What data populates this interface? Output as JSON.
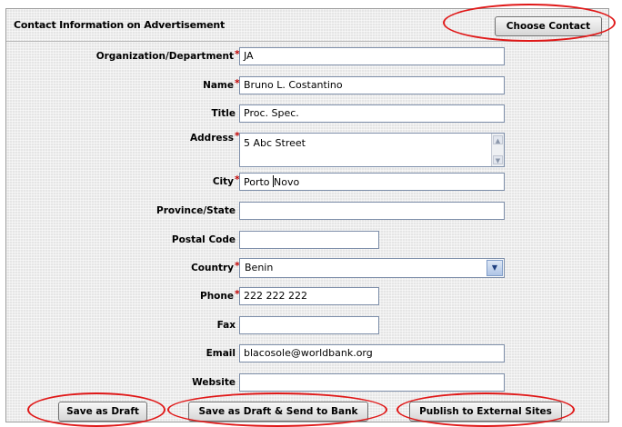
{
  "section_title": "Contact Information on Advertisement",
  "choose_contact_label": "Choose Contact",
  "required_mark": "*",
  "fields": {
    "organization": {
      "label": "Organization/Department",
      "value": "JA"
    },
    "name": {
      "label": "Name",
      "value": "Bruno L. Costantino"
    },
    "title": {
      "label": "Title",
      "value": "Proc. Spec."
    },
    "address": {
      "label": "Address",
      "value": "5 Abc Street"
    },
    "city": {
      "label": "City",
      "value_before_cursor": "Porto ",
      "value_after_cursor": "Novo"
    },
    "province": {
      "label": "Province/State",
      "value": ""
    },
    "postal": {
      "label": "Postal Code",
      "value": ""
    },
    "country": {
      "label": "Country",
      "value": "Benin"
    },
    "phone": {
      "label": "Phone",
      "value": "222 222 222"
    },
    "fax": {
      "label": "Fax",
      "value": ""
    },
    "email": {
      "label": "Email",
      "value": "blacosole@worldbank.org"
    },
    "website": {
      "label": "Website",
      "value": ""
    }
  },
  "buttons": {
    "save_draft": "Save as Draft",
    "save_send": "Save as Draft & Send to Bank",
    "publish": "Publish to External Sites"
  },
  "colors": {
    "highlight": "#e01818",
    "required": "#c00000",
    "input_border": "#7d8ea9"
  }
}
